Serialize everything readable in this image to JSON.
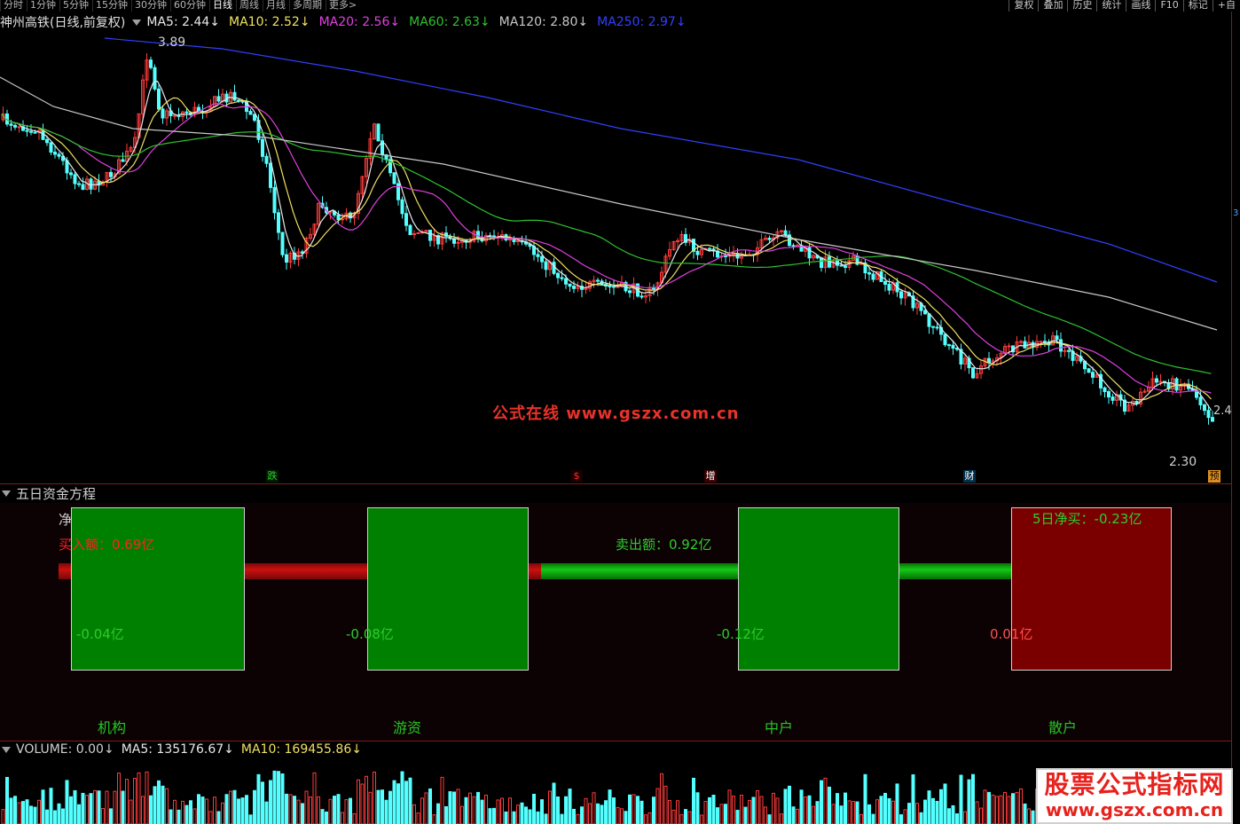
{
  "toolbar": {
    "periods": [
      "分时",
      "1分钟",
      "5分钟",
      "15分钟",
      "30分钟",
      "60分钟",
      "日线",
      "周线",
      "月线",
      "多周期",
      "更多>"
    ],
    "active_period": "日线",
    "tools": [
      "复权",
      "叠加",
      "历史",
      "统计",
      "画线",
      "F10",
      "标记",
      "+自"
    ]
  },
  "main_chart": {
    "stock_label": "神州高铁(日线,前复权)",
    "mas": [
      {
        "label": "MA5: 2.44↓",
        "color": "#e8e8e8"
      },
      {
        "label": "MA10: 2.52↓",
        "color": "#f0e060"
      },
      {
        "label": "MA20: 2.56↓",
        "color": "#e040e0"
      },
      {
        "label": "MA60: 2.63↓",
        "color": "#30c030"
      },
      {
        "label": "MA120: 2.80↓",
        "color": "#c8c8c8"
      },
      {
        "label": "MA250: 2.97↓",
        "color": "#3040ff"
      }
    ],
    "high_label": "3.89",
    "low_label": "2.30",
    "last_label": "2.4",
    "right_axis_label": "3",
    "watermark": "公式在线  www.gszx.com.cn",
    "events": [
      {
        "label": "跌",
        "color": "#30d030",
        "bg": "#001a00"
      },
      {
        "label": "$",
        "color": "#ff3030",
        "bg": "#1a0000"
      },
      {
        "label": "增",
        "color": "#ffffff",
        "bg": "#3a0000"
      },
      {
        "label": "财",
        "color": "#ffffff",
        "bg": "#00304a"
      },
      {
        "label": "预",
        "color": "#000000",
        "bg": "#e09020"
      }
    ],
    "colors": {
      "up": "#ff3b3b",
      "down": "#54ffff"
    }
  },
  "fund_panel": {
    "title": "五日资金方程",
    "net_label": "净",
    "buy_label": "买入额：0.69亿",
    "sell_label": "卖出额：0.92亿",
    "net_buy_label": "5日净买：-0.23亿",
    "boxes": [
      {
        "value": "-0.04亿",
        "color": "#008000",
        "value_color": "#2ecc2e"
      },
      {
        "value": "-0.08亿",
        "color": "#008000",
        "value_color": "#2ecc2e"
      },
      {
        "value": "-0.12亿",
        "color": "#008000",
        "value_color": "#2ecc2e"
      },
      {
        "value": "0.01亿",
        "color": "#7a0000",
        "value_color": "#ff5050"
      }
    ],
    "categories": [
      "机构",
      "游资",
      "中户",
      "散户"
    ],
    "colors": {
      "red": "#cc1010",
      "green": "#14c814"
    }
  },
  "volume_panel": {
    "volume_label": "VOLUME: 0.00↓",
    "ma5_label": "MA5: 135176.67↓",
    "ma10_label": "MA10: 169455.86↓"
  },
  "logo": {
    "main": "股票公式指标网",
    "url": "www.gszx.com.cn"
  }
}
